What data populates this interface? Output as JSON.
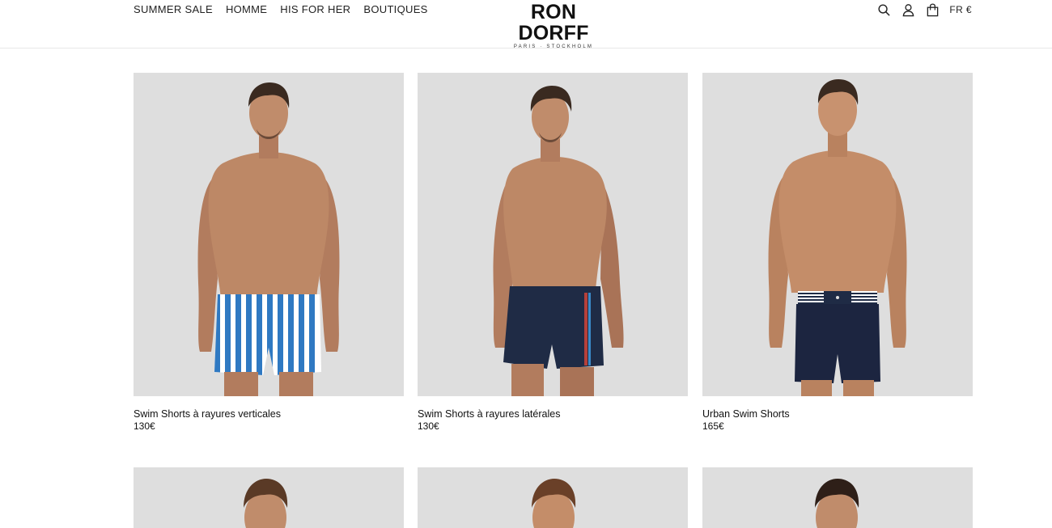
{
  "header": {
    "nav": [
      "SUMMER SALE",
      "HOMME",
      "HIS FOR HER",
      "BOUTIQUES"
    ],
    "brand": "RON DORFF",
    "tagline": "PARIS · STOCKHOLM",
    "locale": "FR €",
    "icons": [
      "search-icon",
      "account-icon",
      "bag-icon"
    ]
  },
  "products": [
    {
      "name": "Swim Shorts à rayures verticales",
      "price": "130€",
      "style": "vertical-stripes"
    },
    {
      "name": "Swim Shorts à rayures latérales",
      "price": "130€",
      "style": "navy-side-stripe"
    },
    {
      "name": "Urban Swim Shorts",
      "price": "165€",
      "style": "navy-striped-waistband"
    }
  ],
  "colors": {
    "photo_bg": "#dedede",
    "skin": "#b98465",
    "navy": "#1f2b45",
    "stripe_blue": "#2f79c2",
    "hair": "#3a2a20"
  }
}
